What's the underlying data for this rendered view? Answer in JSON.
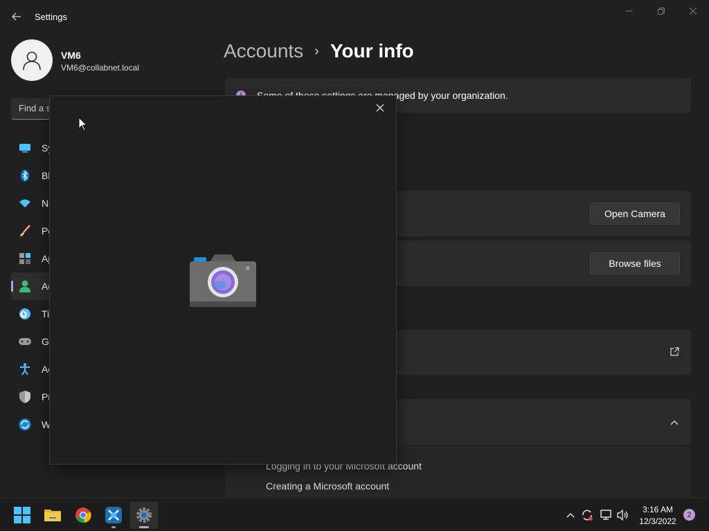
{
  "window": {
    "title": "Settings",
    "back_icon": "back-arrow-icon",
    "min_icon": "minimize-icon",
    "max_icon": "maximize-icon",
    "close_icon": "close-icon"
  },
  "user": {
    "name": "VM6",
    "email": "VM6@collabnet.local"
  },
  "search": {
    "placeholder": "Find a s"
  },
  "sidebar": {
    "items": [
      {
        "label": "Sy",
        "icon": "system-icon",
        "color": "#4cc2ff"
      },
      {
        "label": "Bl",
        "icon": "bluetooth-icon",
        "color": "#0a7cd8"
      },
      {
        "label": "Ne",
        "icon": "wifi-icon",
        "color": "#4cc2ff"
      },
      {
        "label": "Pe",
        "icon": "personalization-brush-icon",
        "color": "#e6a46b"
      },
      {
        "label": "Ap",
        "icon": "apps-icon",
        "color": "#8a8a8a"
      },
      {
        "label": "Ac",
        "icon": "accounts-icon",
        "color": "#3fb97a",
        "active": true
      },
      {
        "label": "Ti",
        "icon": "time-language-icon",
        "color": "#4cc2ff"
      },
      {
        "label": "Ga",
        "icon": "gaming-icon",
        "color": "#9a9a9a"
      },
      {
        "label": "Ac",
        "icon": "accessibility-icon",
        "color": "#4cc2ff"
      },
      {
        "label": "Pr",
        "icon": "privacy-shield-icon",
        "color": "#9a9a9a"
      },
      {
        "label": "W",
        "icon": "windows-update-icon",
        "color": "#4cc2ff"
      }
    ]
  },
  "main": {
    "breadcrumb_parent": "Accounts",
    "breadcrumb_sep": "›",
    "breadcrumb_current": "Your info",
    "info_bar": "Some of these settings are managed by your organization.",
    "open_camera_label": "Open Camera",
    "browse_files_label": "Browse files",
    "related_links": [
      "Logging in to your Microsoft account",
      "Creating a Microsoft account"
    ]
  },
  "camera_dialog": {
    "close_icon": "close-icon",
    "logo_icon": "camera-app-icon"
  },
  "taskbar": {
    "apps": [
      {
        "name": "start-button",
        "icon": "windows-logo-icon"
      },
      {
        "name": "file-explorer",
        "icon": "folder-icon"
      },
      {
        "name": "chrome",
        "icon": "chrome-icon"
      },
      {
        "name": "app-tool",
        "icon": "tool-app-icon"
      },
      {
        "name": "settings",
        "icon": "gear-icon",
        "active": true
      }
    ],
    "time": "3:16 AM",
    "date": "12/3/2022",
    "notification_count": "2"
  },
  "colors": {
    "background": "#202020",
    "card": "#2b2b2b",
    "accent": "#c39ad8"
  }
}
